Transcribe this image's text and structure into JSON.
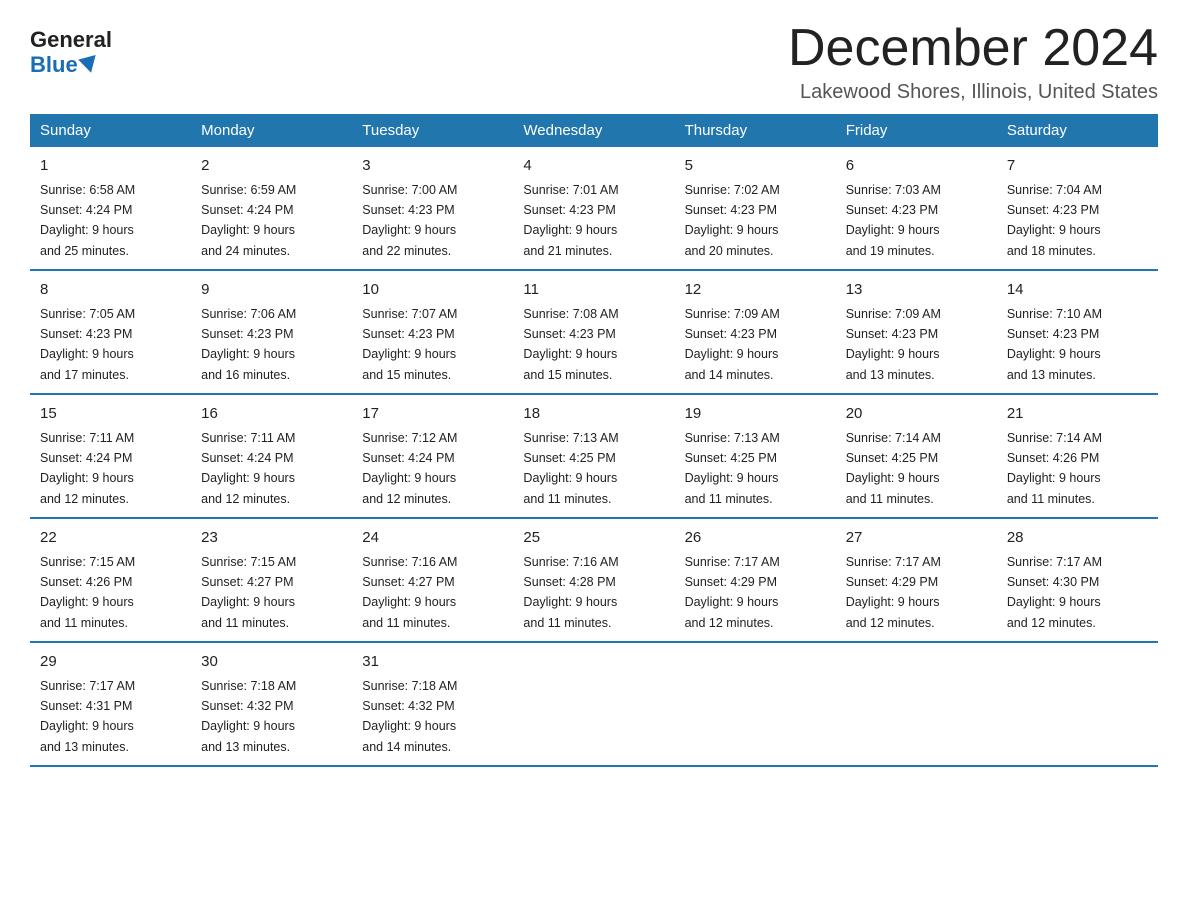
{
  "logo": {
    "general": "General",
    "blue": "Blue"
  },
  "title": "December 2024",
  "location": "Lakewood Shores, Illinois, United States",
  "days_of_week": [
    "Sunday",
    "Monday",
    "Tuesday",
    "Wednesday",
    "Thursday",
    "Friday",
    "Saturday"
  ],
  "weeks": [
    [
      {
        "day": "1",
        "sunrise": "6:58 AM",
        "sunset": "4:24 PM",
        "daylight": "9 hours and 25 minutes."
      },
      {
        "day": "2",
        "sunrise": "6:59 AM",
        "sunset": "4:24 PM",
        "daylight": "9 hours and 24 minutes."
      },
      {
        "day": "3",
        "sunrise": "7:00 AM",
        "sunset": "4:23 PM",
        "daylight": "9 hours and 22 minutes."
      },
      {
        "day": "4",
        "sunrise": "7:01 AM",
        "sunset": "4:23 PM",
        "daylight": "9 hours and 21 minutes."
      },
      {
        "day": "5",
        "sunrise": "7:02 AM",
        "sunset": "4:23 PM",
        "daylight": "9 hours and 20 minutes."
      },
      {
        "day": "6",
        "sunrise": "7:03 AM",
        "sunset": "4:23 PM",
        "daylight": "9 hours and 19 minutes."
      },
      {
        "day": "7",
        "sunrise": "7:04 AM",
        "sunset": "4:23 PM",
        "daylight": "9 hours and 18 minutes."
      }
    ],
    [
      {
        "day": "8",
        "sunrise": "7:05 AM",
        "sunset": "4:23 PM",
        "daylight": "9 hours and 17 minutes."
      },
      {
        "day": "9",
        "sunrise": "7:06 AM",
        "sunset": "4:23 PM",
        "daylight": "9 hours and 16 minutes."
      },
      {
        "day": "10",
        "sunrise": "7:07 AM",
        "sunset": "4:23 PM",
        "daylight": "9 hours and 15 minutes."
      },
      {
        "day": "11",
        "sunrise": "7:08 AM",
        "sunset": "4:23 PM",
        "daylight": "9 hours and 15 minutes."
      },
      {
        "day": "12",
        "sunrise": "7:09 AM",
        "sunset": "4:23 PM",
        "daylight": "9 hours and 14 minutes."
      },
      {
        "day": "13",
        "sunrise": "7:09 AM",
        "sunset": "4:23 PM",
        "daylight": "9 hours and 13 minutes."
      },
      {
        "day": "14",
        "sunrise": "7:10 AM",
        "sunset": "4:23 PM",
        "daylight": "9 hours and 13 minutes."
      }
    ],
    [
      {
        "day": "15",
        "sunrise": "7:11 AM",
        "sunset": "4:24 PM",
        "daylight": "9 hours and 12 minutes."
      },
      {
        "day": "16",
        "sunrise": "7:11 AM",
        "sunset": "4:24 PM",
        "daylight": "9 hours and 12 minutes."
      },
      {
        "day": "17",
        "sunrise": "7:12 AM",
        "sunset": "4:24 PM",
        "daylight": "9 hours and 12 minutes."
      },
      {
        "day": "18",
        "sunrise": "7:13 AM",
        "sunset": "4:25 PM",
        "daylight": "9 hours and 11 minutes."
      },
      {
        "day": "19",
        "sunrise": "7:13 AM",
        "sunset": "4:25 PM",
        "daylight": "9 hours and 11 minutes."
      },
      {
        "day": "20",
        "sunrise": "7:14 AM",
        "sunset": "4:25 PM",
        "daylight": "9 hours and 11 minutes."
      },
      {
        "day": "21",
        "sunrise": "7:14 AM",
        "sunset": "4:26 PM",
        "daylight": "9 hours and 11 minutes."
      }
    ],
    [
      {
        "day": "22",
        "sunrise": "7:15 AM",
        "sunset": "4:26 PM",
        "daylight": "9 hours and 11 minutes."
      },
      {
        "day": "23",
        "sunrise": "7:15 AM",
        "sunset": "4:27 PM",
        "daylight": "9 hours and 11 minutes."
      },
      {
        "day": "24",
        "sunrise": "7:16 AM",
        "sunset": "4:27 PM",
        "daylight": "9 hours and 11 minutes."
      },
      {
        "day": "25",
        "sunrise": "7:16 AM",
        "sunset": "4:28 PM",
        "daylight": "9 hours and 11 minutes."
      },
      {
        "day": "26",
        "sunrise": "7:17 AM",
        "sunset": "4:29 PM",
        "daylight": "9 hours and 12 minutes."
      },
      {
        "day": "27",
        "sunrise": "7:17 AM",
        "sunset": "4:29 PM",
        "daylight": "9 hours and 12 minutes."
      },
      {
        "day": "28",
        "sunrise": "7:17 AM",
        "sunset": "4:30 PM",
        "daylight": "9 hours and 12 minutes."
      }
    ],
    [
      {
        "day": "29",
        "sunrise": "7:17 AM",
        "sunset": "4:31 PM",
        "daylight": "9 hours and 13 minutes."
      },
      {
        "day": "30",
        "sunrise": "7:18 AM",
        "sunset": "4:32 PM",
        "daylight": "9 hours and 13 minutes."
      },
      {
        "day": "31",
        "sunrise": "7:18 AM",
        "sunset": "4:32 PM",
        "daylight": "9 hours and 14 minutes."
      },
      null,
      null,
      null,
      null
    ]
  ],
  "labels": {
    "sunrise": "Sunrise:",
    "sunset": "Sunset:",
    "daylight": "Daylight:"
  }
}
